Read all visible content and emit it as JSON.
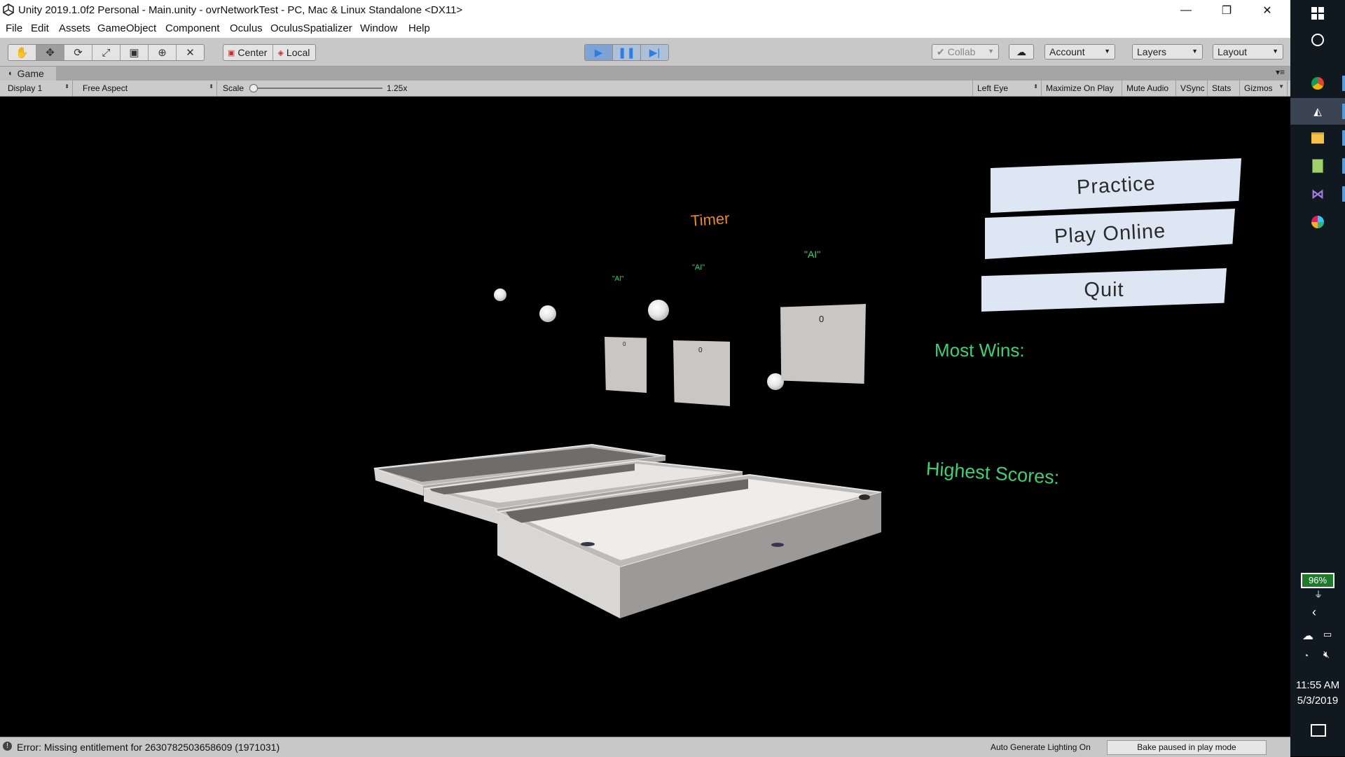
{
  "window": {
    "title": "Unity 2019.1.0f2 Personal - Main.unity - ovrNetworkTest - PC, Mac & Linux Standalone <DX11>",
    "minimize": "—",
    "restore": "❐",
    "close": "✕"
  },
  "menu": [
    "File",
    "Edit",
    "Assets",
    "GameObject",
    "Component",
    "Oculus",
    "OculusSpatializer",
    "Window",
    "Help"
  ],
  "toolbar": {
    "pivot_center": "Center",
    "pivot_local": "Local",
    "collab": "Collab",
    "account": "Account",
    "layers": "Layers",
    "layout": "Layout"
  },
  "game_tab": {
    "label": "Game"
  },
  "game_bar": {
    "display": "Display 1",
    "aspect": "Free Aspect",
    "scale_label": "Scale",
    "scale_value": "1.25x",
    "eye": "Left Eye",
    "maximize": "Maximize On Play",
    "mute": "Mute Audio",
    "vsync": "VSync",
    "stats": "Stats",
    "gizmos": "Gizmos"
  },
  "scene": {
    "timer": "Timer",
    "ai_labels": [
      "\"AI\"",
      "\"AI\"",
      "\"AI\""
    ],
    "scores": [
      "0",
      "0",
      "0"
    ],
    "buttons": {
      "practice": "Practice",
      "play_online": "Play Online",
      "quit": "Quit"
    },
    "most_wins": "Most Wins:",
    "highest_scores": "Highest Scores:",
    "colors": {
      "timer": "#e58a2a",
      "green_text": "#3fcf74",
      "button_bg": "#dde7f4"
    }
  },
  "status": {
    "error": "Error: Missing entitlement for 2630782503658609 (1971031)",
    "lighting": "Auto Generate Lighting On",
    "bake": "Bake paused in play mode"
  },
  "taskbar": {
    "battery": "96%",
    "time": "11:55 AM",
    "date": "5/3/2019"
  }
}
